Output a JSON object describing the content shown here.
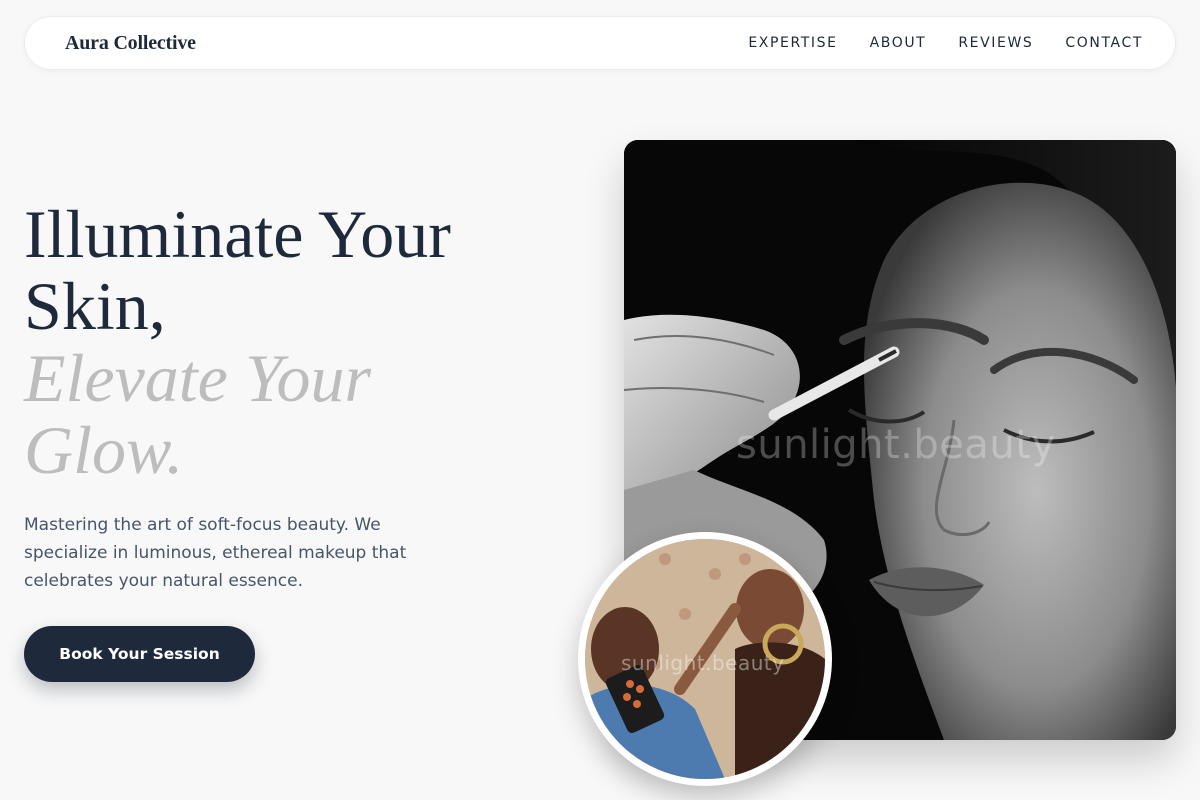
{
  "nav": {
    "brand": "Aura Collective",
    "links": [
      {
        "label": "EXPERTISE"
      },
      {
        "label": "ABOUT"
      },
      {
        "label": "REVIEWS"
      },
      {
        "label": "CONTACT"
      }
    ]
  },
  "hero": {
    "title_line1": "Illuminate Your",
    "title_line2": "Skin,",
    "accent_line1": "Elevate Your",
    "accent_line2": "Glow.",
    "description": "Mastering the art of soft-focus beauty. We specialize in luminous, ethereal makeup that celebrates your natural essence.",
    "cta_label": "Book Your Session"
  },
  "images": {
    "main_watermark": "sunlight.beauty",
    "inset_watermark": "sunlight.beauty"
  },
  "colors": {
    "primary": "#1e293b",
    "accent_text": "#bdbdbd",
    "body_text": "#475569",
    "background": "#f8f8f8"
  }
}
